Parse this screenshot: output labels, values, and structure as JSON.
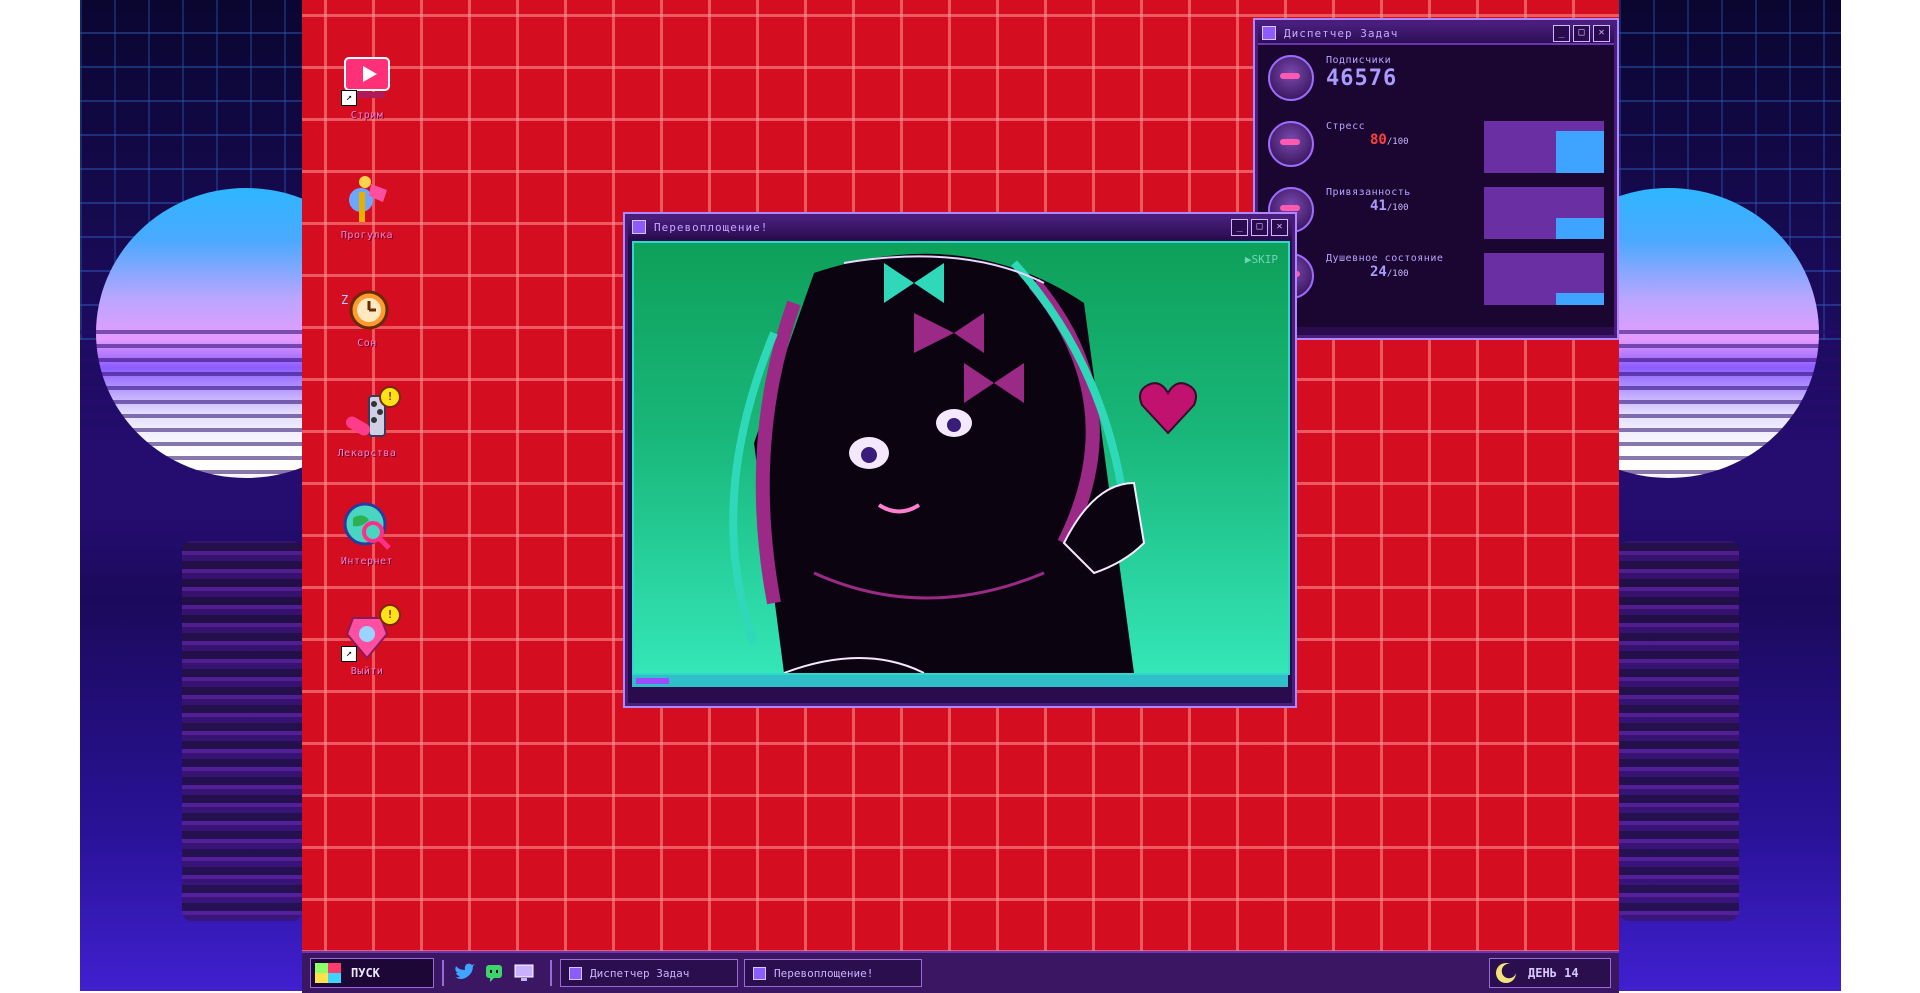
{
  "desktop": {
    "icons": [
      {
        "label": "Стрим",
        "icon": "stream-icon",
        "shortcut": true,
        "badge": ""
      },
      {
        "label": "Прогулка",
        "icon": "walk-icon",
        "shortcut": false,
        "badge": ""
      },
      {
        "label": "Сон",
        "icon": "alarm-clock-icon",
        "shortcut": false,
        "badge": ""
      },
      {
        "label": "Лекарства",
        "icon": "pills-icon",
        "shortcut": false,
        "badge": "!"
      },
      {
        "label": "Интернет",
        "icon": "internet-icon",
        "shortcut": false,
        "badge": ""
      },
      {
        "label": "Выйти",
        "icon": "exit-icon",
        "shortcut": true,
        "badge": "!"
      }
    ]
  },
  "task_manager": {
    "title": "Диспетчер Задач",
    "followers": {
      "label": "Подписчики",
      "value": "46576"
    },
    "stress": {
      "label": "Стресс",
      "value": "80",
      "max": "/100",
      "level": 0.8
    },
    "affection": {
      "label": "Привязанность",
      "value": "41",
      "max": "/100",
      "level": 0.41
    },
    "mental": {
      "label": "Душевное состояние",
      "value": "24",
      "max": "/100",
      "level": 0.24
    }
  },
  "cutscene": {
    "title": "Перевоплощение!",
    "skip_label": "SKIP",
    "progress": 0.05
  },
  "taskbar": {
    "start_label": "ПУСК",
    "quick_launch": [
      "twitter-icon",
      "chat-icon",
      "monitor-icon"
    ],
    "tasks": [
      {
        "label": "Диспетчер Задач"
      },
      {
        "label": "Перевоплощение!"
      }
    ],
    "day_label": "ДЕНЬ 14"
  },
  "colors": {
    "desktop_bg": "#d40e20",
    "window_bg": "#2a0b4e",
    "accent": "#8d5cff",
    "cutscene_bg": "#19b77a"
  }
}
